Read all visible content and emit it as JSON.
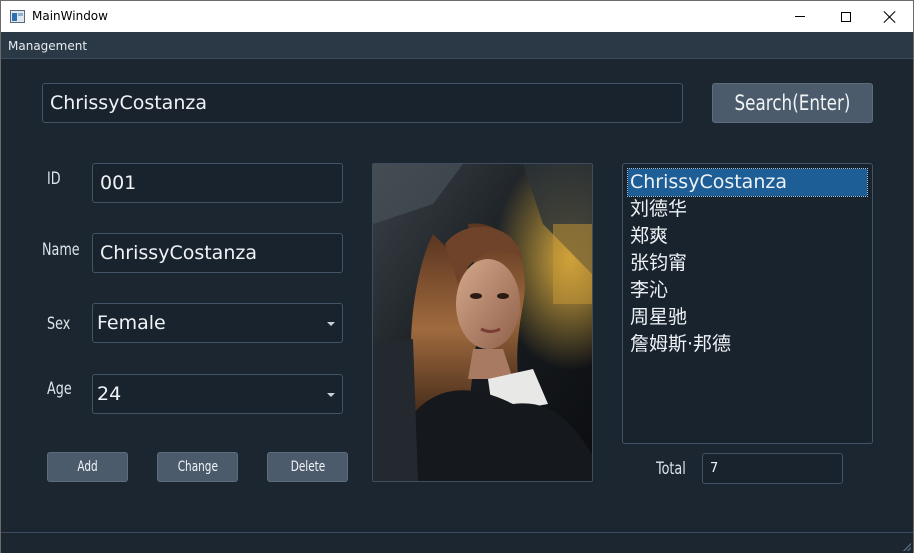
{
  "window": {
    "title": "MainWindow"
  },
  "menubar": {
    "items": [
      {
        "label": "Management"
      }
    ]
  },
  "search": {
    "value": "ChrissyCostanza",
    "button_label": "Search(Enter)"
  },
  "form": {
    "id_label": "ID",
    "id_value": "001",
    "name_label": "Name",
    "name_value": "ChrissyCostanza",
    "sex_label": "Sex",
    "sex_value": "Female",
    "age_label": "Age",
    "age_value": "24"
  },
  "actions": {
    "add_label": "Add",
    "change_label": "Change",
    "delete_label": "Delete"
  },
  "list": {
    "items": [
      {
        "label": "ChrissyCostanza",
        "selected": true
      },
      {
        "label": "刘德华",
        "selected": false
      },
      {
        "label": "郑爽",
        "selected": false
      },
      {
        "label": "张钧甯",
        "selected": false
      },
      {
        "label": "李沁",
        "selected": false
      },
      {
        "label": "周星驰",
        "selected": false
      },
      {
        "label": "詹姆斯·邦德",
        "selected": false
      }
    ]
  },
  "total": {
    "label": "Total",
    "value": "7"
  },
  "colors": {
    "background": "#1c2631",
    "input_background": "#19232d",
    "button": "#4b5b6b",
    "selection": "#1e5e96"
  },
  "icons": {
    "app": "window-app-icon",
    "minimize": "minimize-icon",
    "maximize": "maximize-icon",
    "close": "close-icon",
    "dropdown": "chevron-down-icon",
    "resize": "resize-grip-icon"
  }
}
